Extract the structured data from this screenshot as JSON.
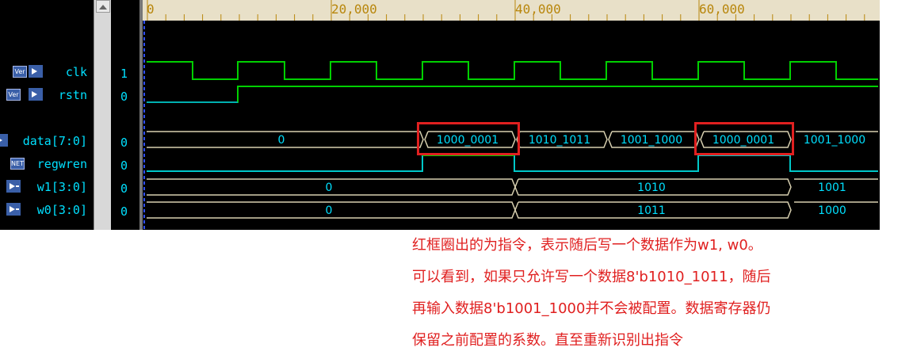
{
  "timeline": {
    "ticks": [
      "0",
      "20,000",
      "40,000",
      "60,000"
    ]
  },
  "signals": [
    {
      "name": "clk",
      "icon": "Ver",
      "value": "1"
    },
    {
      "name": "rstn",
      "icon": "Ver",
      "value": "0"
    },
    {
      "name": "data[7:0]",
      "icon": "",
      "value": "0"
    },
    {
      "name": "regwren",
      "icon": "NET",
      "value": "0"
    },
    {
      "name": "w1[3:0]",
      "icon": "",
      "value": "0"
    },
    {
      "name": "w0[3:0]",
      "icon": "",
      "value": "0"
    }
  ],
  "buses": {
    "data": [
      "0",
      "1000_0001",
      "1010_1011",
      "1001_1000",
      "1000_0001",
      "1001_1000"
    ],
    "w1": [
      "0",
      "1010",
      "1001"
    ],
    "w0": [
      "0",
      "1011",
      "1000"
    ]
  },
  "annotation": {
    "lines": [
      "红框圈出的为指令，表示随后写一个数据作为w1, w0。",
      "可以看到，如果只允许写一个数据8'b1010_1011，随后",
      "再输入数据8'b1001_1000并不会被配置。数据寄存器仍",
      "保留之前配置的系数。直至重新识别出指令"
    ]
  },
  "colors": {
    "clock": "#00d000",
    "bus": "#d8d0b0",
    "highlight": "#e02020",
    "text": "#00e0ff",
    "regwren": "#00c8c8"
  }
}
